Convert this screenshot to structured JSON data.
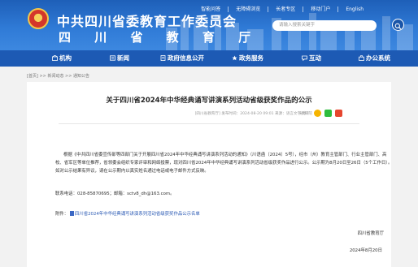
{
  "header": {
    "title": "中共四川省委教育工作委员会",
    "subtitle": "四 川 省 教 育 厅",
    "top_links": [
      "智能问答",
      "无障碍浏览",
      "长者专区",
      "移动门户",
      "English"
    ],
    "search_placeholder": "请输入搜索关键字"
  },
  "nav": {
    "items": [
      {
        "label": "机构",
        "icon": "org-icon"
      },
      {
        "label": "新闻",
        "icon": "news-icon"
      },
      {
        "label": "政府信息公开",
        "icon": "info-icon"
      },
      {
        "label": "政务服务",
        "icon": "service-icon"
      },
      {
        "label": "互动",
        "icon": "interact-icon"
      },
      {
        "label": "办公系统",
        "icon": "office-icon"
      }
    ]
  },
  "breadcrumb": "[首页] >> 新闻动态 >> 通知公告",
  "article": {
    "title": "关于四川省2024年中华经典诵写讲演系列活动省级获奖作品的公示",
    "meta": "[四川省教育厅]  发布时间：2024-08-20 09:01  来源：语言文字教研院",
    "share_label": "分享：",
    "para1": "根据《中共四川省委宣传部等四部门关于开展四川省2024年中华经典诵写讲演系列活动的通知》（川语函〔2024〕5号），经市（州）教育主管部门、行业主管部门、高校、省军区等单位推荐，省领委会组织专家评审和网络投票，现对四川省2024年中华经典诵写讲演系列活动省级获奖作品进行公示。公示期为8月20日至26日（5个工作日）。如对公示结果有异议，请在公示期内以真实姓名通过电话或电子邮件方式反映。",
    "contact": "联系电话：028-85870695；邮箱：sctv8_dh@163.com。",
    "attach_label": "附件：",
    "attach_link": "四川省2024年中华经典诵写讲演系列活动省级获奖作品公示名单",
    "sign_org": "四川省教育厅",
    "sign_date": "2024年8月20日"
  },
  "colors": {
    "header": "#2f7ad6",
    "nav": "#1d5ab4",
    "link": "#2b5ab4"
  }
}
